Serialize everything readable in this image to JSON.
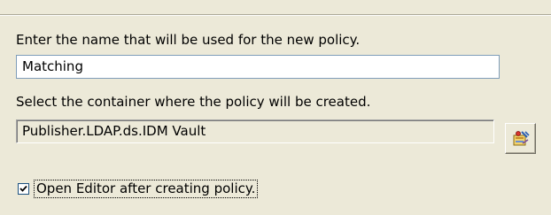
{
  "name_section": {
    "label": "Enter the name that will be used for the new policy.",
    "value": "Matching"
  },
  "container_section": {
    "label": "Select the container where the policy will be created.",
    "value": "Publisher.LDAP.ds.IDM  Vault",
    "browse_icon": "container-browse-icon"
  },
  "options": {
    "open_editor_label": "Open Editor after creating policy.",
    "open_editor_checked": true
  }
}
